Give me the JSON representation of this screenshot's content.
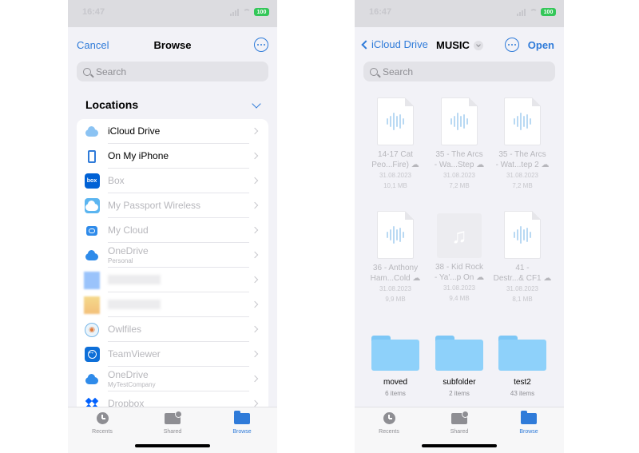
{
  "status": {
    "time": "16:47",
    "battery": "100"
  },
  "left": {
    "nav": {
      "cancel": "Cancel",
      "title": "Browse"
    },
    "search_placeholder": "Search",
    "section_title": "Locations",
    "locations": [
      {
        "label": "iCloud Drive",
        "sub": "",
        "icon": "icloud-icon",
        "dim": false
      },
      {
        "label": "On My iPhone",
        "sub": "",
        "icon": "iphone-icon",
        "dim": false
      },
      {
        "label": "Box",
        "sub": "",
        "icon": "box-icon",
        "dim": true
      },
      {
        "label": "My Passport Wireless",
        "sub": "",
        "icon": "wd-cloud-icon",
        "dim": true
      },
      {
        "label": "My Cloud",
        "sub": "",
        "icon": "mycloud-icon",
        "dim": true
      },
      {
        "label": "OneDrive",
        "sub": "Personal",
        "icon": "onedrive-icon",
        "dim": true
      },
      {
        "label": "",
        "sub": "",
        "icon": "blurred-icon",
        "dim": true
      },
      {
        "label": "",
        "sub": "",
        "icon": "blurred-icon",
        "dim": true
      },
      {
        "label": "Owlfiles",
        "sub": "",
        "icon": "owlfiles-icon",
        "dim": true
      },
      {
        "label": "TeamViewer",
        "sub": "",
        "icon": "teamviewer-icon",
        "dim": true
      },
      {
        "label": "OneDrive",
        "sub": "MyTestCompany",
        "icon": "onedrive-icon",
        "dim": true
      },
      {
        "label": "Dropbox",
        "sub": "",
        "icon": "dropbox-icon",
        "dim": true
      }
    ]
  },
  "right": {
    "nav": {
      "back": "iCloud Drive",
      "title": "MUSIC",
      "open": "Open"
    },
    "search_placeholder": "Search",
    "files": [
      {
        "name1": "14-17 Cat",
        "name2": "Peo...Fire)",
        "date": "31.08.2023",
        "size": "10,1 MB",
        "kind": "audio"
      },
      {
        "name1": "35 - The Arcs",
        "name2": "- Wa...Step",
        "date": "31.08.2023",
        "size": "7,2 MB",
        "kind": "audio"
      },
      {
        "name1": "35 - The Arcs",
        "name2": "- Wat...tep 2",
        "date": "31.08.2023",
        "size": "7,2 MB",
        "kind": "audio"
      },
      {
        "name1": "36 - Anthony",
        "name2": "Ham...Cold",
        "date": "31.08.2023",
        "size": "9,9 MB",
        "kind": "audio"
      },
      {
        "name1": "38 - Kid Rock",
        "name2": "- Ya'...p On",
        "date": "31.08.2023",
        "size": "9,4 MB",
        "kind": "music"
      },
      {
        "name1": "41 -",
        "name2": "Destr...& CF1",
        "date": "31.08.2023",
        "size": "8,1 MB",
        "kind": "audio"
      }
    ],
    "folders": [
      {
        "name": "moved",
        "count": "6 items"
      },
      {
        "name": "subfolder",
        "count": "2 items"
      },
      {
        "name": "test2",
        "count": "43 items"
      }
    ]
  },
  "tabs": [
    {
      "label": "Recents"
    },
    {
      "label": "Shared"
    },
    {
      "label": "Browse"
    }
  ],
  "colors": {
    "accent": "#2f7bd9",
    "folder": "#8ed1fa",
    "battery": "#34c759"
  }
}
